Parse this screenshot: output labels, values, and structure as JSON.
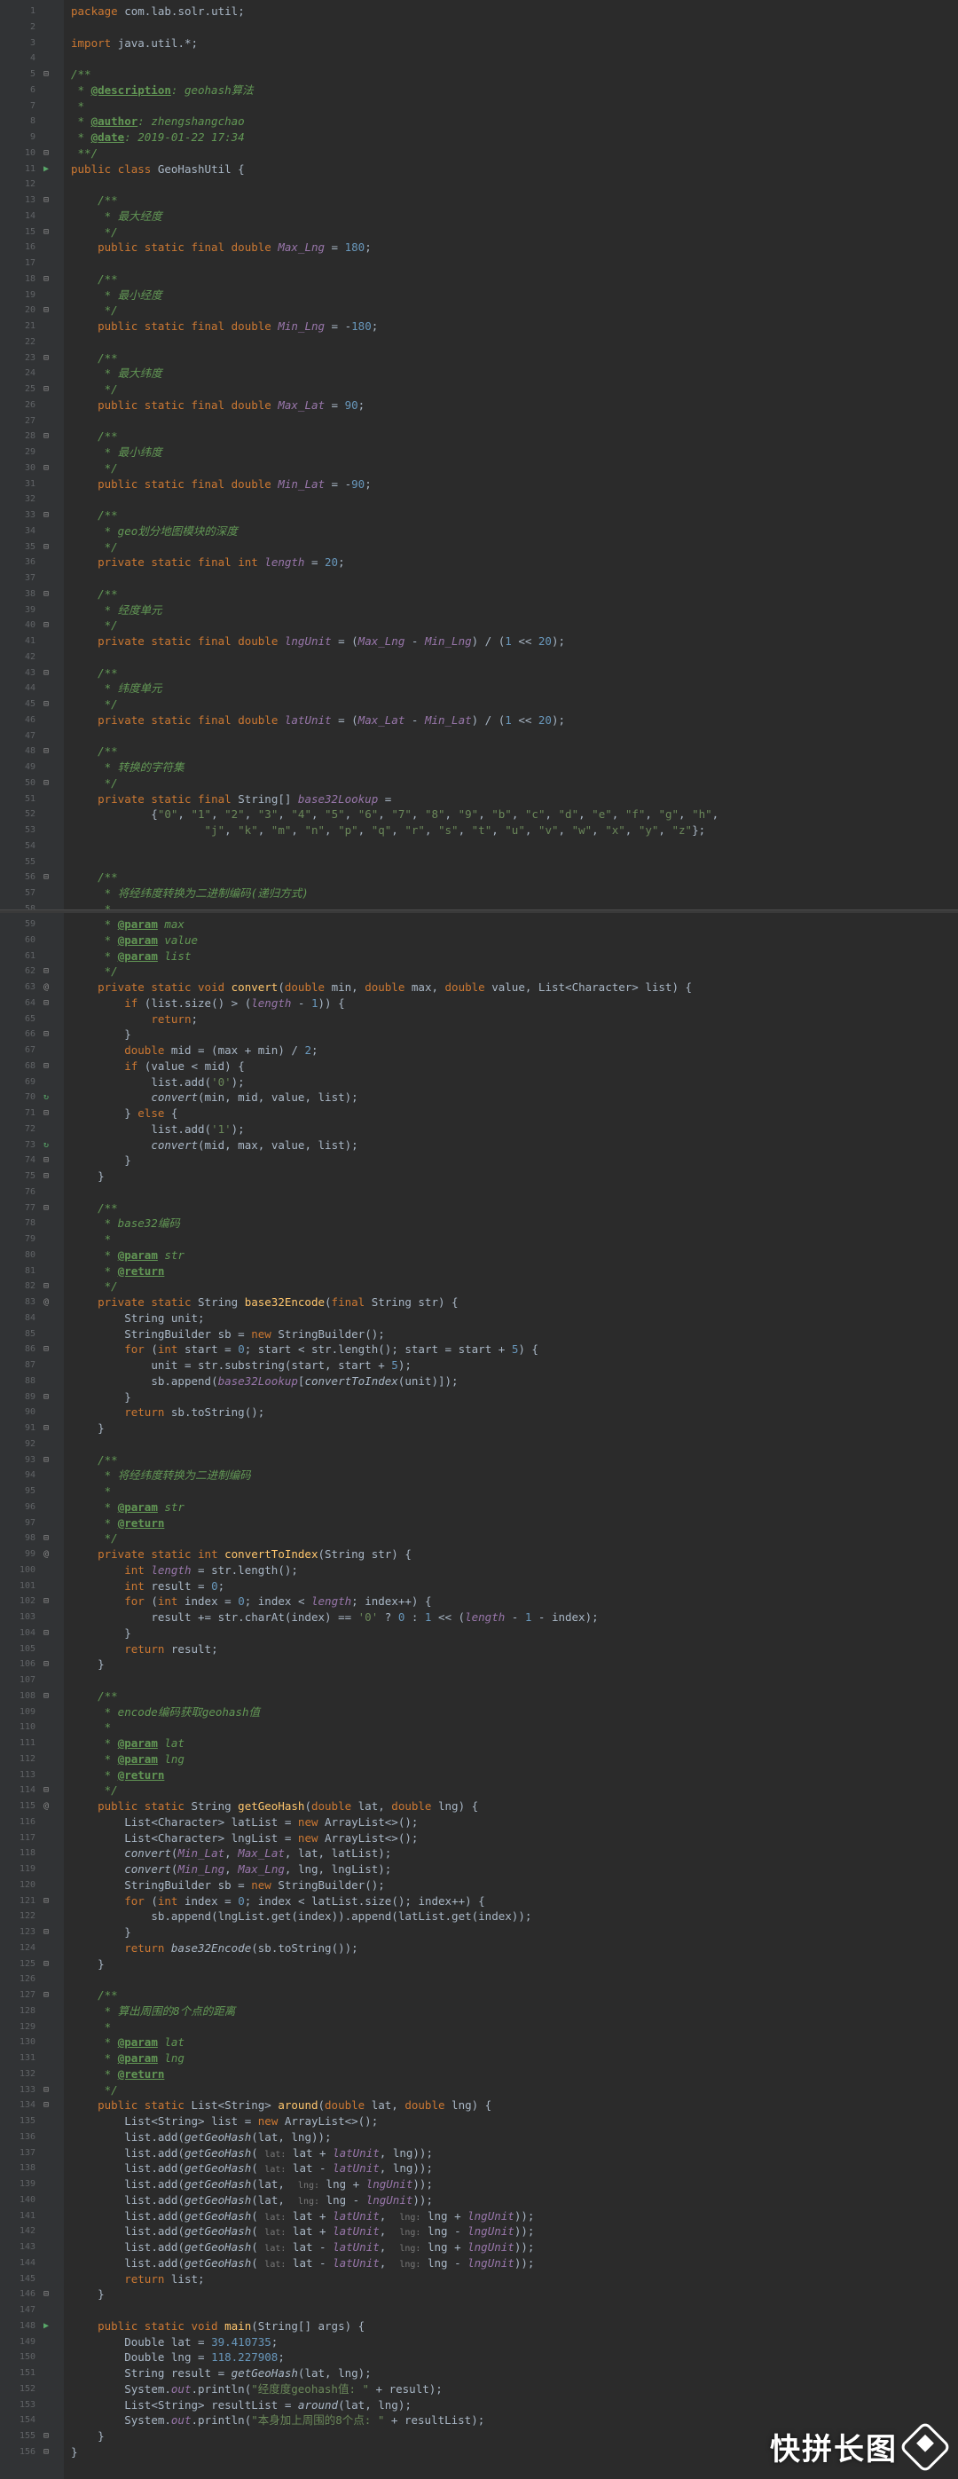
{
  "editor": {
    "colors": {
      "background": "#2b2b2b",
      "gutter": "#313335",
      "keyword": "#cc7832",
      "static_field": "#9876aa",
      "number": "#6897bb",
      "string": "#6a8759",
      "comment": "#629755",
      "method_declaration": "#ffc66d",
      "annotation_tag": "#8a8a3a"
    },
    "panels": [
      {
        "start": 1,
        "lines": [
          {
            "t": "package com.lab.solr.util;"
          },
          {
            "t": ""
          },
          {
            "t": "import java.util.*;"
          },
          {
            "t": ""
          },
          {
            "t": "/**",
            "m": "fold"
          },
          {
            "t": " * @description: geohash算法"
          },
          {
            "t": " *"
          },
          {
            "t": " * @author: zhengshangchao"
          },
          {
            "t": " * @date: 2019-01-22 17:34"
          },
          {
            "t": " **/",
            "m": "fold"
          },
          {
            "t": "public class GeoHashUtil {",
            "m": "run"
          },
          {
            "t": ""
          },
          {
            "t": "    /**",
            "m": "fold"
          },
          {
            "t": "     * 最大经度"
          },
          {
            "t": "     */",
            "m": "fold"
          },
          {
            "t": "    public static final double Max_Lng = 180;"
          },
          {
            "t": ""
          },
          {
            "t": "    /**",
            "m": "fold"
          },
          {
            "t": "     * 最小经度"
          },
          {
            "t": "     */",
            "m": "fold"
          },
          {
            "t": "    public static final double Min_Lng = -180;"
          },
          {
            "t": ""
          },
          {
            "t": "    /**",
            "m": "fold"
          },
          {
            "t": "     * 最大纬度"
          },
          {
            "t": "     */",
            "m": "fold"
          },
          {
            "t": "    public static final double Max_Lat = 90;"
          },
          {
            "t": ""
          },
          {
            "t": "    /**",
            "m": "fold"
          },
          {
            "t": "     * 最小纬度"
          },
          {
            "t": "     */",
            "m": "fold"
          },
          {
            "t": "    public static final double Min_Lat = -90;"
          },
          {
            "t": ""
          },
          {
            "t": "    /**",
            "m": "fold"
          },
          {
            "t": "     * geo划分地图模块的深度"
          },
          {
            "t": "     */",
            "m": "fold"
          },
          {
            "t": "    private static final int length = 20;"
          },
          {
            "t": ""
          },
          {
            "t": "    /**",
            "m": "fold"
          },
          {
            "t": "     * 经度单元"
          },
          {
            "t": "     */",
            "m": "fold"
          },
          {
            "t": "    private static final double lngUnit = (Max_Lng - Min_Lng) / (1 << 20);"
          },
          {
            "t": ""
          },
          {
            "t": "    /**",
            "m": "fold"
          },
          {
            "t": "     * 纬度单元"
          },
          {
            "t": "     */",
            "m": "fold"
          },
          {
            "t": "    private static final double latUnit = (Max_Lat - Min_Lat) / (1 << 20);"
          },
          {
            "t": ""
          },
          {
            "t": "    /**",
            "m": "fold"
          },
          {
            "t": "     * 转换的字符集"
          },
          {
            "t": "     */",
            "m": "fold"
          },
          {
            "t": "    private static final String[] base32Lookup ="
          },
          {
            "t": "            {\"0\", \"1\", \"2\", \"3\", \"4\", \"5\", \"6\", \"7\", \"8\", \"9\", \"b\", \"c\", \"d\", \"e\", \"f\", \"g\", \"h\","
          },
          {
            "t": "                    \"j\", \"k\", \"m\", \"n\", \"p\", \"q\", \"r\", \"s\", \"t\", \"u\", \"v\", \"w\", \"x\", \"y\", \"z\"};"
          },
          {
            "t": ""
          },
          {
            "t": ""
          },
          {
            "t": "    /**",
            "m": "fold"
          },
          {
            "t": "     * 将经纬度转换为二进制编码(递归方式)"
          },
          {
            "t": "     *"
          },
          {
            "t": "     * @param min"
          }
        ]
      },
      {
        "start": 59,
        "lines": [
          {
            "t": "     * @param max"
          },
          {
            "t": "     * @param value"
          },
          {
            "t": "     * @param list"
          },
          {
            "t": "     */",
            "m": "fold"
          },
          {
            "t": "    private static void convert(double min, double max, double value, List<Character> list) {",
            "m": "at"
          },
          {
            "t": "        if (list.size() > (length - 1)) {",
            "m": "fold"
          },
          {
            "t": "            return;"
          },
          {
            "t": "        }",
            "m": "fold"
          },
          {
            "t": "        double mid = (max + min) / 2;"
          },
          {
            "t": "        if (value < mid) {",
            "m": "fold"
          },
          {
            "t": "            list.add('0');"
          },
          {
            "t": "            convert(min, mid, value, list);",
            "m": "rec"
          },
          {
            "t": "        } else {",
            "m": "fold"
          },
          {
            "t": "            list.add('1');"
          },
          {
            "t": "            convert(mid, max, value, list);",
            "m": "rec"
          },
          {
            "t": "        }",
            "m": "fold"
          },
          {
            "t": "    }",
            "m": "fold"
          },
          {
            "t": ""
          },
          {
            "t": "    /**",
            "m": "fold"
          },
          {
            "t": "     * base32编码"
          },
          {
            "t": "     *"
          },
          {
            "t": "     * @param str"
          },
          {
            "t": "     * @return"
          },
          {
            "t": "     */",
            "m": "fold"
          },
          {
            "t": "    private static String base32Encode(final String str) {",
            "m": "at"
          },
          {
            "t": "        String unit;"
          },
          {
            "t": "        StringBuilder sb = new StringBuilder();"
          },
          {
            "t": "        for (int start = 0; start < str.length(); start = start + 5) {",
            "m": "fold"
          },
          {
            "t": "            unit = str.substring(start, start + 5);"
          },
          {
            "t": "            sb.append(base32Lookup[convertToIndex(unit)]);"
          },
          {
            "t": "        }",
            "m": "fold"
          },
          {
            "t": "        return sb.toString();"
          },
          {
            "t": "    }",
            "m": "fold"
          },
          {
            "t": ""
          },
          {
            "t": "    /**",
            "m": "fold"
          },
          {
            "t": "     * 将经纬度转换为二进制编码"
          },
          {
            "t": "     *"
          },
          {
            "t": "     * @param str"
          },
          {
            "t": "     * @return"
          },
          {
            "t": "     */",
            "m": "fold"
          },
          {
            "t": "    private static int convertToIndex(String str) {",
            "m": "at"
          },
          {
            "t": "        int length = str.length();"
          },
          {
            "t": "        int result = 0;"
          },
          {
            "t": "        for (int index = 0; index < length; index++) {",
            "m": "fold"
          },
          {
            "t": "            result += str.charAt(index) == '0' ? 0 : 1 << (length - 1 - index);"
          },
          {
            "t": "        }",
            "m": "fold"
          },
          {
            "t": "        return result;"
          },
          {
            "t": "    }",
            "m": "fold"
          },
          {
            "t": ""
          },
          {
            "t": "    /**",
            "m": "fold"
          },
          {
            "t": "     * encode编码获取geohash值"
          },
          {
            "t": "     *"
          },
          {
            "t": "     * @param lat"
          },
          {
            "t": "     * @param lng"
          },
          {
            "t": "     * @return"
          },
          {
            "t": "     */",
            "m": "fold"
          },
          {
            "t": "    public static String getGeoHash(double lat, double lng) {",
            "m": "at"
          },
          {
            "t": "        List<Character> latList = new ArrayList<>();"
          },
          {
            "t": "        List<Character> lngList = new ArrayList<>();"
          },
          {
            "t": "        convert(Min_Lat, Max_Lat, lat, latList);"
          },
          {
            "t": "        convert(Min_Lng, Max_Lng, lng, lngList);"
          },
          {
            "t": "        StringBuilder sb = new StringBuilder();"
          },
          {
            "t": "        for (int index = 0; index < latList.size(); index++) {",
            "m": "fold"
          },
          {
            "t": "            sb.append(lngList.get(index)).append(latList.get(index));"
          },
          {
            "t": "        }",
            "m": "fold"
          },
          {
            "t": "        return base32Encode(sb.toString());"
          },
          {
            "t": "    }",
            "m": "fold"
          },
          {
            "t": ""
          },
          {
            "t": "    /**",
            "m": "fold"
          },
          {
            "t": "     * 算出周围的8个点的距离"
          },
          {
            "t": "     *"
          },
          {
            "t": "     * @param lat"
          },
          {
            "t": "     * @param lng"
          },
          {
            "t": "     * @return"
          },
          {
            "t": "     */",
            "m": "fold"
          },
          {
            "t": "    public static List<String> around(double lat, double lng) {",
            "m": "fold"
          },
          {
            "t": "        List<String> list = new ArrayList<>();"
          },
          {
            "t": "        list.add(getGeoHash(lat, lng));"
          },
          {
            "t": "        list.add(getGeoHash( lat: lat + latUnit, lng));"
          },
          {
            "t": "        list.add(getGeoHash( lat: lat - latUnit, lng));"
          },
          {
            "t": "        list.add(getGeoHash(lat,  lng: lng + lngUnit));"
          },
          {
            "t": "        list.add(getGeoHash(lat,  lng: lng - lngUnit));"
          },
          {
            "t": "        list.add(getGeoHash( lat: lat + latUnit,  lng: lng + lngUnit));"
          },
          {
            "t": "        list.add(getGeoHash( lat: lat + latUnit,  lng: lng - lngUnit));"
          },
          {
            "t": "        list.add(getGeoHash( lat: lat - latUnit,  lng: lng + lngUnit));"
          },
          {
            "t": "        list.add(getGeoHash( lat: lat - latUnit,  lng: lng - lngUnit));"
          },
          {
            "t": "        return list;"
          },
          {
            "t": "    }",
            "m": "fold"
          },
          {
            "t": ""
          },
          {
            "t": "    public static void main(String[] args) {",
            "m": "run"
          },
          {
            "t": "        Double lat = 39.410735;"
          },
          {
            "t": "        Double lng = 118.227908;"
          },
          {
            "t": "        String result = getGeoHash(lat, lng);"
          },
          {
            "t": "        System.out.println(\"经度度geohash值: \" + result);"
          },
          {
            "t": "        List<String> resultList = around(lat, lng);"
          },
          {
            "t": "        System.out.println(\"本身加上周围的8个点: \" + resultList);"
          },
          {
            "t": "    }",
            "m": "fold"
          },
          {
            "t": "}",
            "m": "fold"
          }
        ]
      }
    ]
  },
  "watermark": {
    "text": "快拼长图",
    "logo_icon": "kuaipin-logo-icon"
  }
}
